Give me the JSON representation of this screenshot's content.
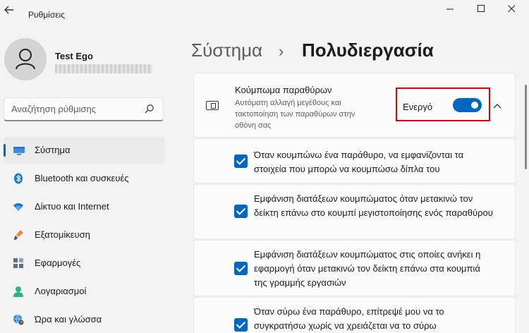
{
  "window": {
    "app_title": "Ρυθμίσεις",
    "back_icon": "back-arrow-icon",
    "minimize_glyph": "—",
    "maximize_glyph": "☐",
    "close_glyph": "✕"
  },
  "user": {
    "name": "Test Ego"
  },
  "search": {
    "placeholder": "Αναζήτηση ρύθμισης",
    "icon": "search-icon"
  },
  "sidebar": {
    "items": [
      {
        "label": "Σύστημα",
        "icon": "system-icon",
        "active": true
      },
      {
        "label": "Bluetooth και συσκευές",
        "icon": "bluetooth-icon"
      },
      {
        "label": "Δίκτυο και Internet",
        "icon": "wifi-icon"
      },
      {
        "label": "Εξατομίκευση",
        "icon": "brush-icon"
      },
      {
        "label": "Εφαρμογές",
        "icon": "apps-icon"
      },
      {
        "label": "Λογαριασμοί",
        "icon": "account-icon"
      },
      {
        "label": "Ώρα και γλώσσα",
        "icon": "globe-clock-icon"
      }
    ]
  },
  "breadcrumb": {
    "parent": "Σύστημα",
    "separator": "›",
    "current": "Πολυδιεργασία"
  },
  "snap": {
    "title": "Κούμπωμα παραθύρων",
    "description": "Αυτόματη αλλαγή μεγέθους και τακτοποίηση των παραθύρων στην οθόνη σας",
    "toggle_label": "Ενεργό",
    "toggle_on": true,
    "expanded": true,
    "collapse_glyph": "⌃",
    "highlight_color": "#e00000"
  },
  "options": [
    {
      "text": "Όταν κουμπώνω ένα παράθυρο, να εμφανίζονται τα στοιχεία που μπορώ να κουμπώσω δίπλα του",
      "checked": true
    },
    {
      "text": "Εμφάνιση διατάξεων κουμπώματος όταν μετακινώ τον δείκτη επάνω στο κουμπί μεγιστοποίησης ενός παραθύρου",
      "checked": true
    },
    {
      "text": "Εμφάνιση διατάξεων κουμπώματος στις οποίες ανήκει η εφαρμογή όταν μετακινώ τον δείκτη επάνω στα κουμπιά της γραμμής εργασιών",
      "checked": true
    },
    {
      "text": "Όταν σύρω ένα παράθυρο, επίτρεψέ μου να το συγκρατήσω χωρίς να χρειάζεται να το σύρω",
      "checked": true
    }
  ],
  "colors": {
    "accent": "#0067c0",
    "background": "#f3f3f3",
    "card": "#fbfbfb"
  }
}
